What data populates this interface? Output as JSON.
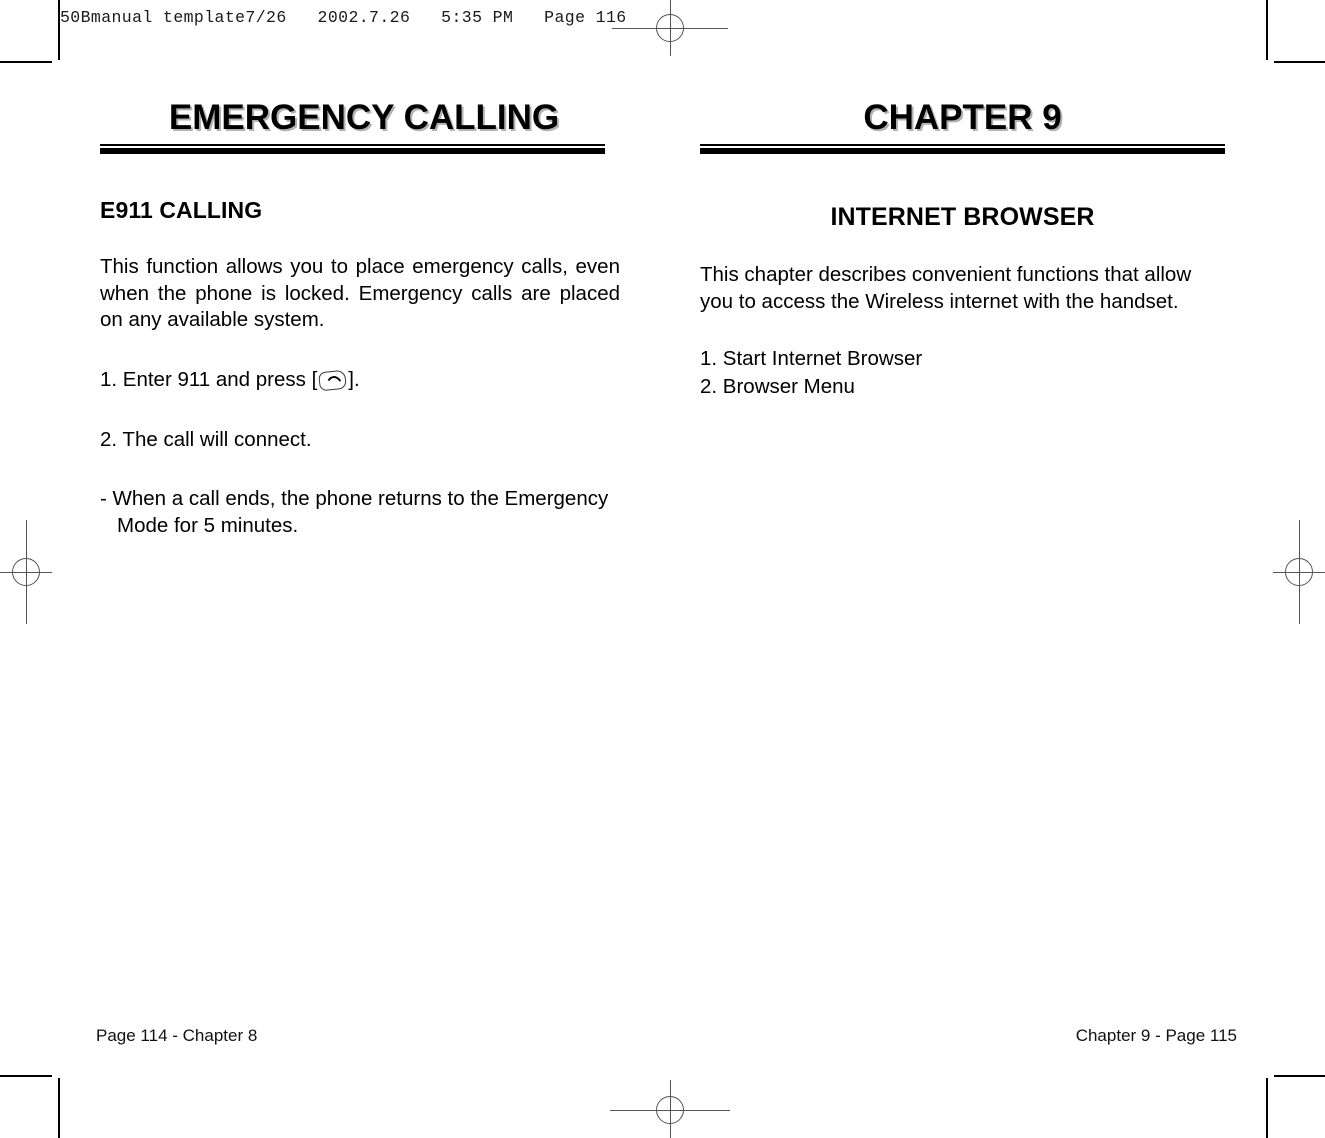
{
  "film_header": {
    "text": "50Bmanual template7/26   2002.7.26   5:35 PM   Page 116"
  },
  "left_column": {
    "banner_title": "EMERGENCY CALLING",
    "section_heading": "E911 CALLING",
    "intro_paragraph": "This function allows you to place emergency calls, even when the phone is locked. Emergency calls are placed on any available system.",
    "step1_before_icon": "1. Enter 911 and press [",
    "step1_icon_name": "send-key-icon",
    "step1_after_icon": "].",
    "step2": "2. The call will connect.",
    "note": "- When a call ends, the phone returns to the Emergency Mode for 5 minutes.",
    "footer": "Page 114 - Chapter 8"
  },
  "right_column": {
    "banner_title": "CHAPTER 9",
    "section_heading": "INTERNET BROWSER",
    "intro_paragraph": "This chapter describes convenient functions that allow you to access the Wireless internet with the handset.",
    "toc": [
      "1. Start Internet Browser",
      "2. Browser Menu"
    ],
    "footer": "Chapter 9 - Page 115"
  },
  "colors": {
    "text": "#000000",
    "rule": "#000000",
    "registration_mark": "#555555",
    "page_background": "#ffffff"
  }
}
